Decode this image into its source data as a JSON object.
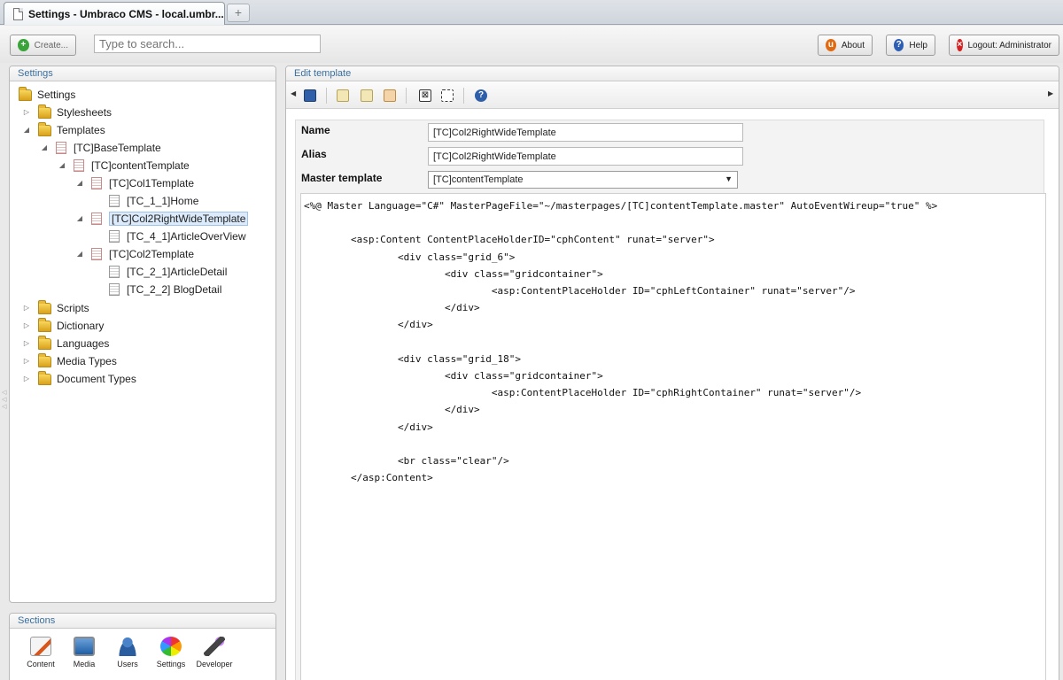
{
  "browser": {
    "tab_title": "Settings - Umbraco CMS - local.umbr...",
    "new_tab_symbol": "+"
  },
  "topbar": {
    "create_label": "Create...",
    "search_placeholder": "Type to search...",
    "about_label": "About",
    "help_label": "Help",
    "logout_label": "Logout: Administrator"
  },
  "settings_panel": {
    "title": "Settings",
    "tree": [
      {
        "label": "Settings",
        "icon": "folder-icon",
        "arrow": ""
      },
      {
        "label": "Stylesheets",
        "icon": "folder-icon",
        "arrow": "▷"
      },
      {
        "label": "Templates",
        "icon": "folder-icon",
        "arrow": "◢"
      },
      {
        "label": "[TC]BaseTemplate",
        "icon": "template-icon",
        "arrow": "◢"
      },
      {
        "label": "[TC]contentTemplate",
        "icon": "template-icon",
        "arrow": "◢"
      },
      {
        "label": "[TC]Col1Template",
        "icon": "template-icon",
        "arrow": "◢"
      },
      {
        "label": "[TC_1_1]Home",
        "icon": "document-icon",
        "arrow": ""
      },
      {
        "label": "[TC]Col2RightWideTemplate",
        "icon": "template-icon",
        "arrow": "◢",
        "selected": true
      },
      {
        "label": "[TC_4_1]ArticleOverView",
        "icon": "document-icon",
        "arrow": ""
      },
      {
        "label": "[TC]Col2Template",
        "icon": "template-icon",
        "arrow": "◢"
      },
      {
        "label": "[TC_2_1]ArticleDetail",
        "icon": "document-icon",
        "arrow": ""
      },
      {
        "label": "[TC_2_2] BlogDetail",
        "icon": "document-icon",
        "arrow": ""
      },
      {
        "label": "Scripts",
        "icon": "folder-icon",
        "arrow": "▷"
      },
      {
        "label": "Dictionary",
        "icon": "folder-icon",
        "arrow": "▷"
      },
      {
        "label": "Languages",
        "icon": "folder-icon",
        "arrow": "▷"
      },
      {
        "label": "Media Types",
        "icon": "folder-icon",
        "arrow": "▷"
      },
      {
        "label": "Document Types",
        "icon": "folder-icon",
        "arrow": "▷"
      }
    ]
  },
  "sections_panel": {
    "title": "Sections",
    "items": [
      {
        "label": "Content",
        "icon": "content-icon"
      },
      {
        "label": "Media",
        "icon": "media-icon"
      },
      {
        "label": "Users",
        "icon": "users-icon"
      },
      {
        "label": "Settings",
        "icon": "settings-icon"
      },
      {
        "label": "Developer",
        "icon": "developer-icon"
      }
    ]
  },
  "edit_panel": {
    "title": "Edit template",
    "toolbar_icons": [
      "save-icon",
      "insert-field-icon",
      "insert-macro-icon",
      "insert-content-area-icon",
      "insert-placeholder-icon",
      "insert-content-placeholder-icon",
      "help-icon"
    ],
    "form": {
      "name_label": "Name",
      "name_value": "[TC]Col2RightWideTemplate",
      "alias_label": "Alias",
      "alias_value": "[TC]Col2RightWideTemplate",
      "master_label": "Master template",
      "master_value": "[TC]contentTemplate"
    },
    "code": "<%@ Master Language=\"C#\" MasterPageFile=\"~/masterpages/[TC]contentTemplate.master\" AutoEventWireup=\"true\" %>\n\n        <asp:Content ContentPlaceHolderID=\"cphContent\" runat=\"server\">\n                <div class=\"grid_6\">\n                        <div class=\"gridcontainer\">\n                                <asp:ContentPlaceHolder ID=\"cphLeftContainer\" runat=\"server\"/>\n                        </div>\n                </div>\n\n                <div class=\"grid_18\">\n                        <div class=\"gridcontainer\">\n                                <asp:ContentPlaceHolder ID=\"cphRightContainer\" runat=\"server\"/>\n                        </div>\n                </div>\n\n                <br class=\"clear\"/>\n        </asp:Content>"
  },
  "colors": {
    "panel_title": "#3b6e9c",
    "selected_bg": "#dcebfb"
  }
}
